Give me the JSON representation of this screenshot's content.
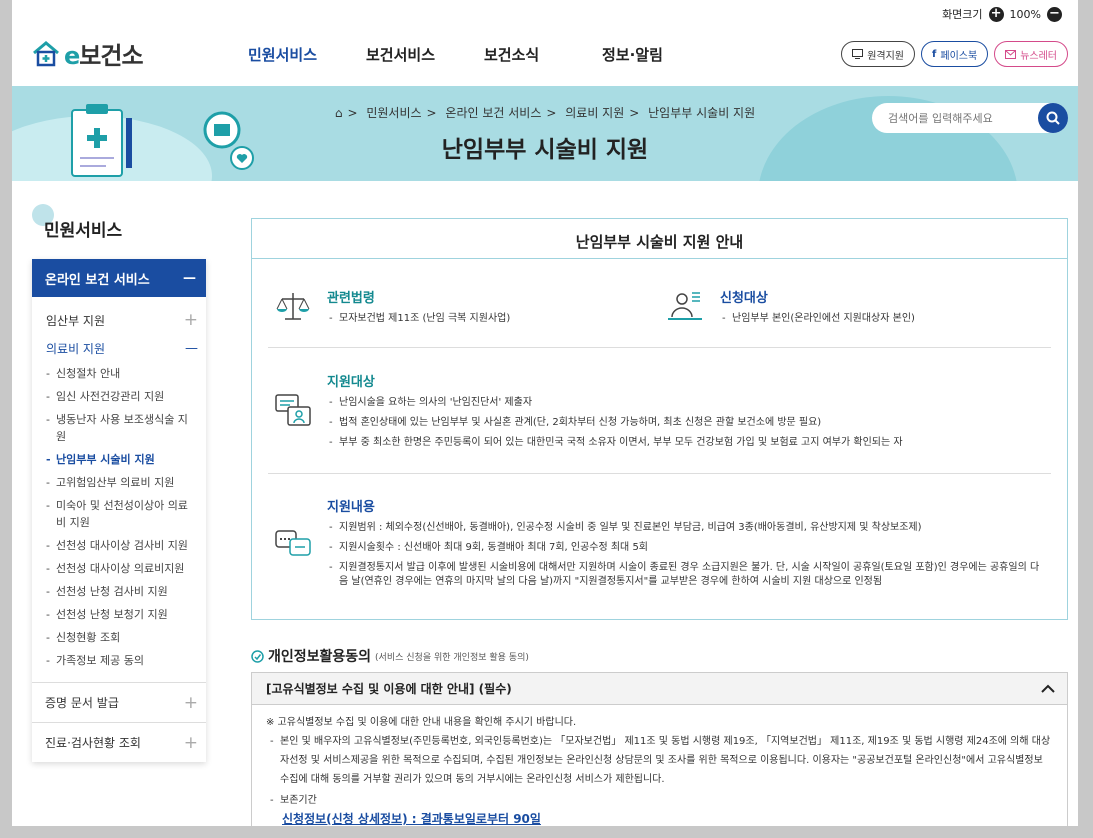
{
  "util": {
    "font_size_label": "화면크기",
    "zoom": "100%"
  },
  "logo": {
    "e": "e",
    "text": "보건소"
  },
  "gnb": [
    "민원서비스",
    "보건서비스",
    "보건소식",
    "정보·알림"
  ],
  "header_buttons": {
    "remote": "원격지원",
    "facebook": "페이스북",
    "newsletter": "뉴스레터"
  },
  "breadcrumb": [
    "민원서비스",
    "온라인 보건 서비스",
    "의료비 지원",
    "난임부부 시술비 지원"
  ],
  "page_title": "난임부부 시술비 지원",
  "search": {
    "placeholder": "검색어를 입력해주세요"
  },
  "sidebar": {
    "title": "민원서비스",
    "active_group": "온라인 보건 서비스",
    "items": [
      {
        "label": "임산부 지원"
      },
      {
        "label": "의료비 지원"
      }
    ],
    "subitems": [
      "신청절차 안내",
      "임신 사전건강관리 지원",
      "냉동난자 사용 보조생식술 지원",
      "난임부부 시술비 지원",
      "고위험임산부 의료비 지원",
      "미숙아 및 선천성이상아 의료비 지원",
      "선천성 대사이상 검사비 지원",
      "선천성 대사이상 의료비지원",
      "선천성 난청 검사비 지원",
      "선천성 난청 보청기 지원",
      "신청현황 조회",
      "가족정보 제공 동의"
    ],
    "footer": [
      "증명 문서 발급",
      "진료·검사현황 조회"
    ]
  },
  "info": {
    "title": "난임부부 시술비 지원 안내",
    "law": {
      "heading": "관련법령",
      "item": "모자보건법 제11조 (난임 극복 지원사업)"
    },
    "applicant": {
      "heading": "신청대상",
      "item": "난임부부 본인(온라인에선 지원대상자 본인)"
    },
    "target": {
      "heading": "지원대상",
      "items": [
        "난임시술을 요하는 의사의 '난임진단서' 제출자",
        "법적 혼인상태에 있는 난임부부 및 사실혼 관계(단, 2회차부터 신청 가능하며, 최초 신청은 관할 보건소에 방문 필요)",
        "부부 중 최소한 한명은 주민등록이 되어 있는 대한민국 국적 소유자 이면서, 부부 모두 건강보험 가입 및 보험료 고지 여부가 확인되는 자"
      ]
    },
    "content": {
      "heading": "지원내용",
      "items": [
        "지원범위 : 체외수정(신선배아, 동결배아), 인공수정 시술비 중 일부 및 진료본인 부담금, 비급여 3종(배아동결비, 유산방지제 및 착상보조제)",
        "지원시술횟수 : 신선배아 최대 9회, 동결배아 최대 7회, 인공수정 최대 5회",
        "지원결정통지서 발급 이후에 발생된 시술비용에 대해서만 지원하며 시술이 종료된 경우 소급지원은 불가. 단, 시술 시작일이 공휴일(토요일 포함)인 경우에는 공휴일의 다음 날(연휴인 경우에는 연휴의 마지막 날의 다음 날)까지 \"지원결정통지서\"를 교부받은 경우에 한하여 시술비 지원 대상으로 인정됨"
      ]
    }
  },
  "consent": {
    "title": "개인정보활용동의",
    "subtitle": "(서비스 신청을 위한 개인정보 활용 동의)",
    "box_title": "[고유식별정보 수집 및 이용에 대한 안내] (필수)",
    "notice": "※ 고유식별정보 수집 및 이용에 대한 안내 내용을 확인해 주시기 바랍니다.",
    "item1": "본인 및 배우자의 고유식별정보(주민등록번호, 외국인등록번호)는 「모자보건법」 제11조 및 동법 시행령 제19조, 「지역보건법」 제11조, 제19조 및 동법 시행령 제24조에 의해 대상자선정 및 서비스제공을 위한 목적으로 수집되며, 수집된 개인정보는 온라인신청 상담문의 및 조사를 위한 목적으로 이용됩니다. 이용자는 \"공공보건포털 온라인신청\"에서 고유식별정보 수집에 대해 동의를 거부할 권리가 있으며 동의 거부시에는 온라인신청 서비스가 제한됩니다.",
    "item2": "보존기간",
    "retention": "신청정보(신청 상세정보) : 결과통보일로부터 90일"
  }
}
